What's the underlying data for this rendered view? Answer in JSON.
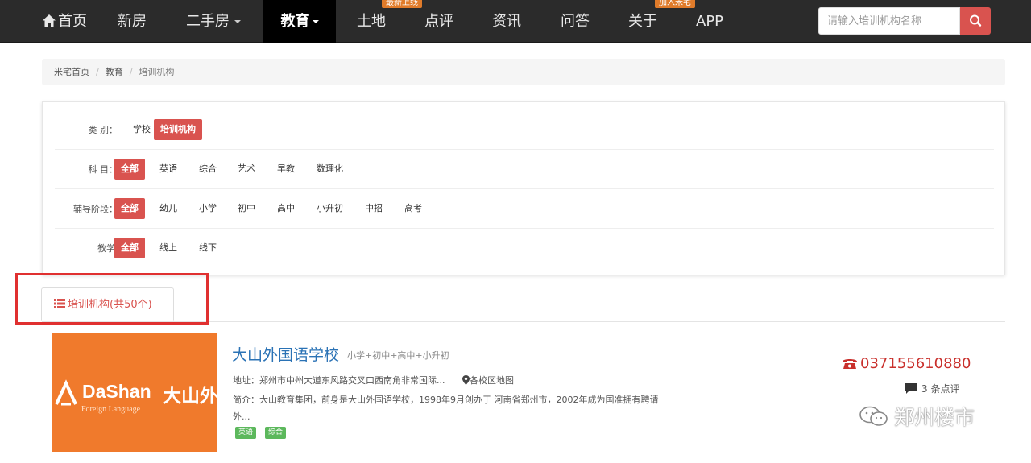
{
  "nav": {
    "items": [
      {
        "label": "首页",
        "icon": "home-icon"
      },
      {
        "label": "新房"
      },
      {
        "label": "二手房",
        "dropdown": true
      },
      {
        "label": "教育",
        "dropdown": true,
        "active": true
      },
      {
        "label": "土地",
        "badge": "最新上线"
      },
      {
        "label": "点评"
      },
      {
        "label": "资讯"
      },
      {
        "label": "问答"
      },
      {
        "label": "关于",
        "badge": "加入米宅"
      },
      {
        "label": "APP"
      }
    ],
    "search_placeholder": "请输入培训机构名称",
    "search_icon": "search-icon"
  },
  "breadcrumb": [
    "米宅首页",
    "教育",
    "培训机构"
  ],
  "filters": [
    {
      "label": "类 别：",
      "options": [
        "学校",
        "培训机构"
      ],
      "selected": "培训机构"
    },
    {
      "label": "科 目：",
      "options": [
        "全部",
        "英语",
        "综合",
        "艺术",
        "早教",
        "数理化"
      ],
      "selected": "全部"
    },
    {
      "label": "辅导阶段：",
      "options": [
        "全部",
        "幼儿",
        "小学",
        "初中",
        "高中",
        "小升初",
        "中招",
        "高考"
      ],
      "selected": "全部"
    },
    {
      "label": "教学模式：",
      "options": [
        "全部",
        "线上",
        "线下"
      ],
      "selected": "全部"
    }
  ],
  "results_tab": {
    "label": "培训机构(共50个)",
    "icon": "list-icon"
  },
  "result": {
    "logo_text_en": "DaShan",
    "logo_text_cn": "大山外",
    "logo_sub": "Foreign Language",
    "name": "大山外国语学校",
    "levels": "小学+初中+高中+小升初",
    "address": "地址：郑州市中州大道东风路交叉口西南角非常国际...",
    "map_link": "各校区地图",
    "intro": "简介：大山教育集团，前身是大山外国语学校，1998年9月创办于 河南省郑州市，2002年成为国准拥有聘请外...",
    "tags": [
      "英语",
      "综合"
    ],
    "phone": "037155610880",
    "reviews": "3 条点评"
  },
  "watermark": "郑州楼市",
  "colors": {
    "nav_bg": "#2b2b2b",
    "accent_red": "#d9534f",
    "badge_orange": "#e07b2a",
    "link_blue": "#2a72b5",
    "tag_green": "#5cb85c",
    "logo_orange": "#f07a2c",
    "highlight_box": "#e03030"
  }
}
